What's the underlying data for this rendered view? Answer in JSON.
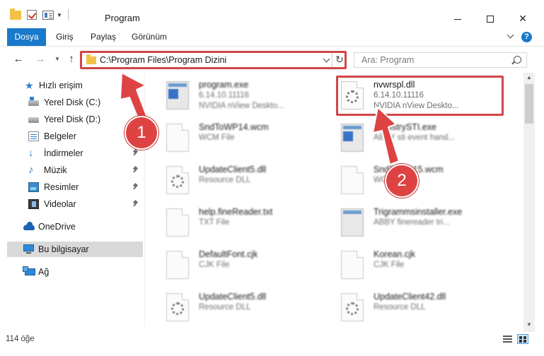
{
  "window": {
    "title": "Program",
    "minimize_icon": "minimize-icon",
    "maximize_icon": "maximize-icon",
    "close_icon": "close-icon"
  },
  "ribbon": {
    "tabs": [
      {
        "label": "Dosya",
        "active": true
      },
      {
        "label": "Giriş"
      },
      {
        "label": "Paylaş"
      },
      {
        "label": "Görünüm"
      }
    ],
    "help_label": "?"
  },
  "address": {
    "path": "C:\\Program Files\\Program Dizini",
    "refresh_icon": "↻",
    "search_placeholder": "Ara: Program"
  },
  "sidebar": {
    "items": [
      {
        "label": "Hızlı erişim",
        "icon": "quick-access-icon",
        "pinned": false
      },
      {
        "label": "Yerel Disk (C:)",
        "icon": "drive-c-icon",
        "pinned": false
      },
      {
        "label": "Yerel Disk (D:)",
        "icon": "drive-d-icon",
        "pinned": false
      },
      {
        "label": "Belgeler",
        "icon": "documents-icon",
        "pinned": false
      },
      {
        "label": "İndirmeler",
        "icon": "downloads-icon",
        "pinned": true
      },
      {
        "label": "Müzik",
        "icon": "music-icon",
        "pinned": true
      },
      {
        "label": "Resimler",
        "icon": "pictures-icon",
        "pinned": true
      },
      {
        "label": "Videolar",
        "icon": "videos-icon",
        "pinned": true
      },
      {
        "label": "OneDrive",
        "icon": "onedrive-icon",
        "pinned": false
      },
      {
        "label": "Bu bilgisayar",
        "icon": "this-pc-icon",
        "pinned": false,
        "selected": true
      },
      {
        "label": "Ağ",
        "icon": "network-icon",
        "pinned": false
      }
    ]
  },
  "files": [
    {
      "name": "program.exe",
      "line1": "6.14.10.11116",
      "line2": "NVIDIA nView Deskto...",
      "icon": "exe-icon",
      "blurred": true
    },
    {
      "name": "nvwrspl.dll",
      "line1": "6.14.10.11116",
      "line2": "NVIDIA nView Deskto...",
      "icon": "dll-icon",
      "blurred": false,
      "selected": true
    },
    {
      "name": "SndToWP14.wcm",
      "line1": "WCM File",
      "line2": "",
      "icon": "file-icon",
      "blurred": true
    },
    {
      "name": "RegistrySTI.exe",
      "line1": "ABBY sti event hand...",
      "line2": "",
      "icon": "exe-icon",
      "blurred": true
    },
    {
      "name": "UpdateClient5.dll",
      "line1": "Resource DLL",
      "line2": "",
      "icon": "dll-icon",
      "blurred": true
    },
    {
      "name": "SndToWP15.wcm",
      "line1": "WCM File",
      "line2": "",
      "icon": "file-icon",
      "blurred": true
    },
    {
      "name": "help.fineReader.txt",
      "line1": "TXT File",
      "line2": "",
      "icon": "file-icon",
      "blurred": true
    },
    {
      "name": "Trigrammsinstaller.exe",
      "line1": "ABBY finereader tri...",
      "line2": "",
      "icon": "exe-icon",
      "blurred": true
    },
    {
      "name": "DefaultFont.cjk",
      "line1": "CJK File",
      "line2": "",
      "icon": "file-icon",
      "blurred": true
    },
    {
      "name": "Korean.cjk",
      "line1": "CJK File",
      "line2": "",
      "icon": "file-icon",
      "blurred": true
    },
    {
      "name": "UpdateClient5.dll",
      "line1": "Resource DLL",
      "line2": "",
      "icon": "dll-icon",
      "blurred": true
    },
    {
      "name": "UpdateClient42.dll",
      "line1": "Resource DLL",
      "line2": "",
      "icon": "dll-icon",
      "blurred": true
    }
  ],
  "status": {
    "count": "114 öğe"
  },
  "annotations": {
    "badge1": "1",
    "badge2": "2",
    "color": "#de4343"
  },
  "colors": {
    "accent": "#1979ca",
    "highlight": "#d24546",
    "selection": "#cce8ff"
  }
}
